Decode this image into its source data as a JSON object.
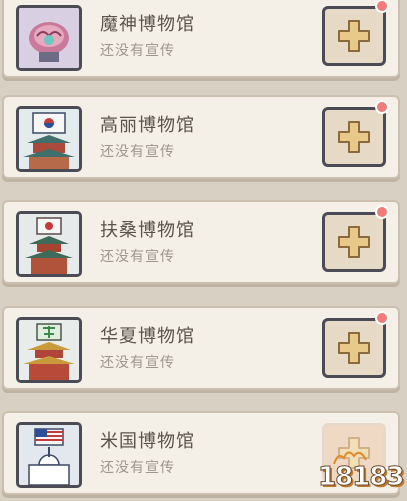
{
  "museums": [
    {
      "name": "魔神博物馆",
      "status": "还没有宣传",
      "icon": "demon-brain-icon"
    },
    {
      "name": "高丽博物馆",
      "status": "还没有宣传",
      "icon": "korea-palace-icon"
    },
    {
      "name": "扶桑博物馆",
      "status": "还没有宣传",
      "icon": "japan-pagoda-icon"
    },
    {
      "name": "华夏博物馆",
      "status": "还没有宣传",
      "icon": "china-palace-icon"
    },
    {
      "name": "米国博物馆",
      "status": "还没有宣传",
      "icon": "us-capitol-icon"
    }
  ],
  "colors": {
    "card_bg": "#f4efe7",
    "text": "#5a534a",
    "subtext": "#9d968c",
    "badge": "#f07b78",
    "plus": "#e8c98a"
  },
  "watermark": {
    "text": "18183"
  }
}
